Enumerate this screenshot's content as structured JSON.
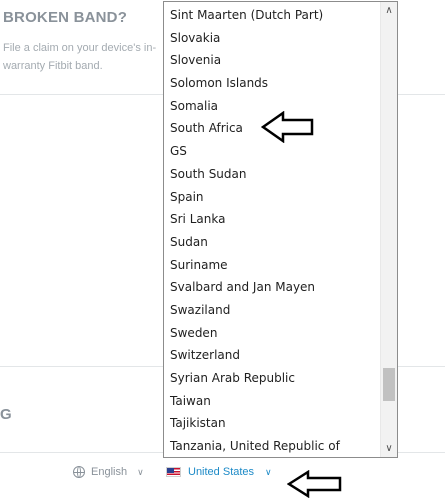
{
  "promo": {
    "title": "BROKEN BAND?",
    "text": "File a claim on your device's in-warranty Fitbit band."
  },
  "partial_heading": "G",
  "country_list": {
    "items": [
      "Sint Maarten (Dutch Part)",
      "Slovakia",
      "Slovenia",
      "Solomon Islands",
      "Somalia",
      "South Africa",
      "GS",
      "South Sudan",
      "Spain",
      "Sri Lanka",
      "Sudan",
      "Suriname",
      "Svalbard and Jan Mayen",
      "Swaziland",
      "Sweden",
      "Switzerland",
      "Syrian Arab Republic",
      "Taiwan",
      "Tajikistan",
      "Tanzania, United Republic of"
    ]
  },
  "footer": {
    "language": "English",
    "country": "United States"
  },
  "colors": {
    "accent_link": "#1d8ac7",
    "muted_text": "#8a929a"
  },
  "icons": {
    "language": "globe-icon",
    "country": "us-flag-icon",
    "annotation": "left-arrow-icon"
  }
}
